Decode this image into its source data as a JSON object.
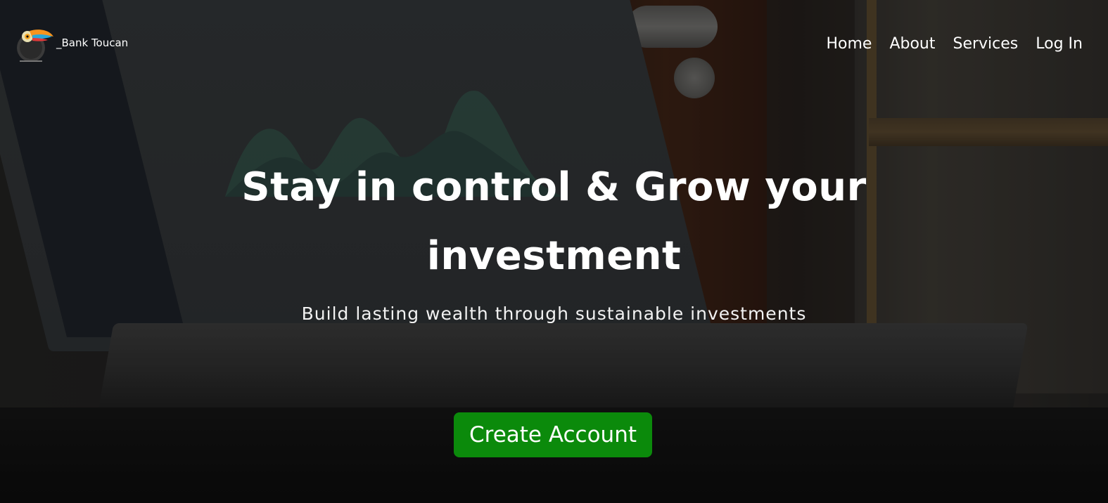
{
  "brand": {
    "name": "_Bank Toucan",
    "logo_icon": "toucan-logo-icon"
  },
  "nav": {
    "items": [
      {
        "label": "Home"
      },
      {
        "label": "About"
      },
      {
        "label": "Services"
      },
      {
        "label": "Log In"
      }
    ]
  },
  "hero": {
    "headline": "Stay in control & Grow your investment",
    "subheadline": "Build lasting wealth through sustainable investments",
    "cta_label": "Create Account"
  },
  "colors": {
    "cta_background": "#0b8a0b",
    "text": "#ffffff",
    "overlay": "rgba(0,0,0,0.40)"
  }
}
